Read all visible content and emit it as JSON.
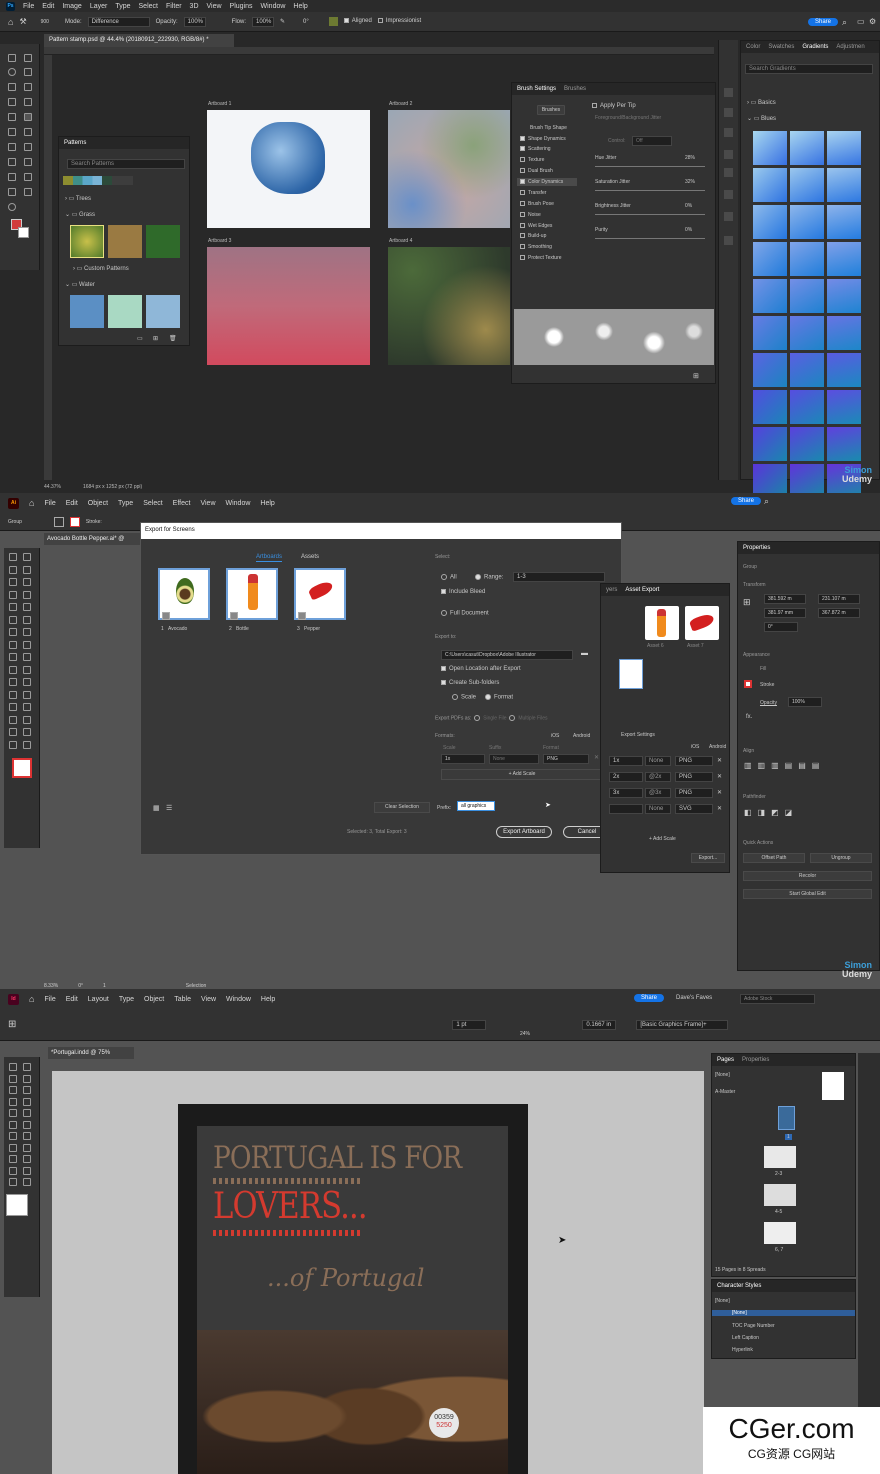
{
  "photoshop": {
    "menu": [
      "File",
      "Edit",
      "Image",
      "Layer",
      "Type",
      "Select",
      "Filter",
      "3D",
      "View",
      "Plugins",
      "Window",
      "Help"
    ],
    "options": {
      "size": "900",
      "mode_label": "Mode:",
      "mode": "Difference",
      "opacity_label": "Opacity:",
      "opacity": "100%",
      "flow_label": "Flow:",
      "flow": "100%",
      "angle": "0°",
      "aligned": "Aligned",
      "impressionist": "Impressionist",
      "share": "Share"
    },
    "doc_tab": "Pattern stamp.psd @ 44.4% (20180912_222930, RGB/8#) *",
    "artboards": [
      "Artboard 1",
      "Artboard 2",
      "Artboard 3",
      "Artboard 4"
    ],
    "patterns": {
      "title": "Patterns",
      "search_placeholder": "Search Patterns",
      "groups": [
        "Trees",
        "Grass",
        "Custom Patterns",
        "Water"
      ]
    },
    "brush_settings": {
      "tabs": [
        "Brush Settings",
        "Brushes"
      ],
      "brushes_btn": "Brushes",
      "apply_per_tip": "Apply Per Tip",
      "fg_bg_jitter": "Foreground/Background Jitter",
      "control": "Control:",
      "control_val": "Off",
      "items": [
        "Brush Tip Shape",
        "Shape Dynamics",
        "Scattering",
        "Texture",
        "Dual Brush",
        "Color Dynamics",
        "Transfer",
        "Brush Pose",
        "Noise",
        "Wet Edges",
        "Build-up",
        "Smoothing",
        "Protect Texture"
      ],
      "hue_jitter": "Hue Jitter",
      "hue_val": "28%",
      "sat_jitter": "Saturation Jitter",
      "sat_val": "32%",
      "bri_jitter": "Brightness Jitter",
      "bri_val": "0%",
      "purity": "Purity",
      "purity_val": "0%"
    },
    "gradients": {
      "tabs": [
        "Color",
        "Swatches",
        "Gradients",
        "Adjustmen"
      ],
      "search_placeholder": "Search Gradients",
      "groups": [
        "Basics",
        "Blues"
      ]
    },
    "status": {
      "zoom": "44.37%",
      "size": "1684 px x 1252 px (72 ppi)"
    }
  },
  "illustrator": {
    "menu": [
      "File",
      "Edit",
      "Object",
      "Type",
      "Select",
      "Effect",
      "View",
      "Window",
      "Help"
    ],
    "share": "Share",
    "group_label": "Group",
    "stroke_label": "Stroke:",
    "doc_tab": "Avocado Bottle Pepper.ai* @",
    "dialog": {
      "title": "Export for Screens",
      "tabs": [
        "Artboards",
        "Assets"
      ],
      "thumbs": [
        {
          "num": "1",
          "name": "Avocado"
        },
        {
          "num": "2",
          "name": "Bottle"
        },
        {
          "num": "3",
          "name": "Pepper"
        }
      ],
      "select_label": "Select:",
      "all": "All",
      "range": "Range:",
      "range_val": "1-3",
      "include_bleed": "Include Bleed",
      "full_document": "Full Document",
      "export_to": "Export to:",
      "path": "C:\\Users\\casut\\Dropbox\\Adobe Illustrator",
      "open_location": "Open Location after Export",
      "create_sub": "Create Sub-folders",
      "scale": "Scale",
      "format": "Format",
      "export_pdfs": "Export PDFs as:",
      "single_file": "Single File",
      "multiple_files": "Multiple Files",
      "formats": "Formats:",
      "ios": "iOS",
      "android": "Android",
      "col_scale": "Scale",
      "col_suffix": "Suffix",
      "col_format": "Format",
      "scale_val": "1x",
      "suffix_ph": "None",
      "format_val": "PNG",
      "add_scale": "+ Add Scale",
      "clear_selection": "Clear Selection",
      "prefix_label": "Prefix:",
      "prefix_val": "all graphics",
      "selected_info": "Selected: 3, Total Export: 3",
      "export_btn": "Export Artboard",
      "cancel_btn": "Cancel"
    },
    "asset_export": {
      "tabs": [
        "yers",
        "Asset Export"
      ],
      "assets": [
        "Asset 6",
        "Asset 7"
      ],
      "settings": "Export Settings",
      "ios": "iOS",
      "android": "Android",
      "rows": [
        {
          "scale": "1x",
          "suffix": "None",
          "format": "PNG"
        },
        {
          "scale": "2x",
          "suffix": "@2x",
          "format": "PNG"
        },
        {
          "scale": "3x",
          "suffix": "@3x",
          "format": "PNG"
        },
        {
          "scale": "",
          "suffix": "None",
          "format": "SVG"
        }
      ],
      "add_scale": "+ Add Scale",
      "export_btn": "Export..."
    },
    "properties": {
      "title": "Properties",
      "group": "Group",
      "transform": "Transform",
      "x": "381.592 m",
      "w": "231.107 m",
      "y": "381.97 mm",
      "h": "367.872 m",
      "angle": "0°",
      "appearance": "Appearance",
      "fill": "Fill",
      "stroke": "Stroke",
      "opacity": "Opacity",
      "opacity_val": "100%",
      "fx": "fx.",
      "align": "Align",
      "pathfinder": "Pathfinder",
      "quick_actions": "Quick Actions",
      "offset_path": "Offset Path",
      "ungroup": "Ungroup",
      "recolor": "Recolor",
      "start_global": "Start Global Edit"
    },
    "status": {
      "zoom": "8.33%",
      "angle": "0°",
      "page": "1",
      "mode": "Selection"
    }
  },
  "indesign": {
    "menu": [
      "File",
      "Edit",
      "Layout",
      "Type",
      "Object",
      "Table",
      "View",
      "Window",
      "Help"
    ],
    "share": "Share",
    "workspace": "Dave's Faves",
    "search_placeholder": "Adobe Stock",
    "stroke_pt": "1 pt",
    "tint": "0.1667 in",
    "zoom_pct": "24%",
    "frame_style": "[Basic Graphics Frame]+",
    "doc_tab": "*Portugal.indd @ 75%",
    "poster": {
      "line1": "PORTUGAL IS FOR",
      "line2": "LOVERS...",
      "line3": "...of Portugal",
      "barrel_tag1": "00359",
      "barrel_tag2": "5250"
    },
    "pages": {
      "tabs": [
        "Pages",
        "Properties"
      ],
      "none": "[None]",
      "master": "A-Master",
      "labels": [
        "1",
        "2-3",
        "4-5",
        "6, 7"
      ],
      "count": "15 Pages in 8 Spreads"
    },
    "char_styles": {
      "title": "Character Styles",
      "current": "[None]",
      "items": [
        "[None]",
        "TOC Page Number",
        "Left Caption",
        "Hyperlink"
      ]
    }
  },
  "watermarks": {
    "simon": "Simon",
    "udemy": "Udemy",
    "cger": "CGer.com",
    "cger_sub": "CG资源 CG网站"
  },
  "colors": {
    "ps_blue": "#31a8ff",
    "ai_orange": "#ff9a00",
    "id_pink": "#ff3366",
    "accent": "#1473e6"
  }
}
